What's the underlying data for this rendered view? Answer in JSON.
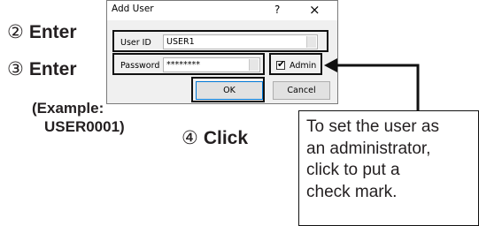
{
  "annotations": {
    "step2": {
      "num": "②",
      "label": "Enter"
    },
    "step3": {
      "num": "③",
      "label": "Enter"
    },
    "example_line1": "(Example:",
    "example_line2": "USER0001)",
    "step4": {
      "num": "④",
      "label": "Click"
    }
  },
  "dialog": {
    "title": "Add User",
    "help_glyph": "?",
    "close_glyph": "×",
    "user_id_label": "User ID",
    "user_id_value": "USER1",
    "password_label": "Password",
    "password_value": "********",
    "admin_label": "Admin",
    "admin_checked": true,
    "ok_label": "OK",
    "cancel_label": "Cancel"
  },
  "callout": {
    "lines": [
      "To set the user as",
      "an administrator,",
      "click to put a",
      "check mark."
    ]
  }
}
